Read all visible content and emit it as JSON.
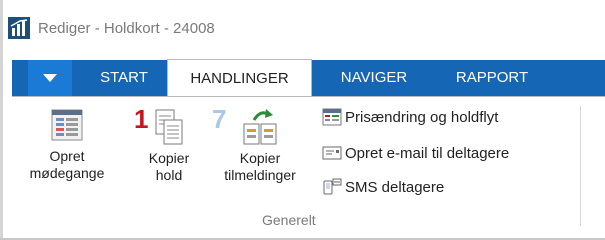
{
  "window": {
    "title": "Rediger - Holdkort - 24008"
  },
  "ribbon": {
    "tabs": [
      {
        "label": "START"
      },
      {
        "label": "HANDLINGER"
      },
      {
        "label": "NAVIGER"
      },
      {
        "label": "RAPPORT"
      }
    ],
    "selected_tab": "HANDLINGER",
    "group": {
      "label": "Generelt",
      "big_buttons": [
        {
          "line1": "Opret",
          "line2": "mødegange",
          "icon": "list-form-icon"
        },
        {
          "line1": "Kopier",
          "line2": "hold",
          "icon": "copy-document-icon",
          "badge": "1"
        },
        {
          "line1": "Kopier",
          "line2": "tilmeldinger",
          "icon": "copy-enrollments-icon",
          "badge": "7"
        }
      ],
      "small_buttons": [
        {
          "label": "Prisændring og holdflyt",
          "icon": "price-change-icon"
        },
        {
          "label": "Opret e-mail til deltagere",
          "icon": "email-icon"
        },
        {
          "label": "SMS deltagere",
          "icon": "phone-sms-icon"
        }
      ]
    }
  },
  "colors": {
    "ribbon_blue": "#1566b4",
    "app_menu_blue": "#1a7ad6",
    "badge_red": "#c8141e",
    "badge_blue": "#a9c8ec",
    "arrow_green": "#2e8b3a"
  }
}
